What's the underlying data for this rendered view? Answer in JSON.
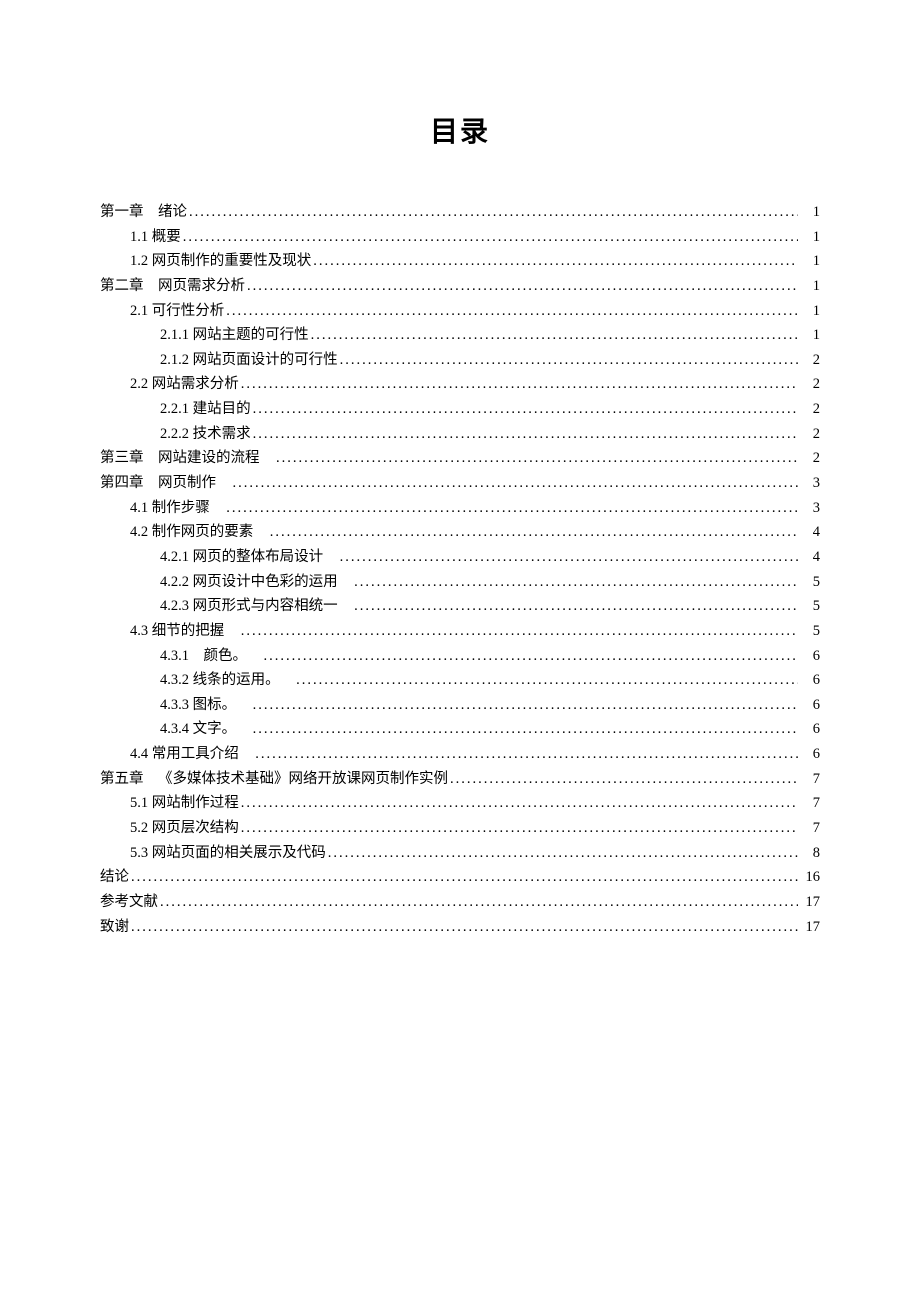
{
  "title": "目录",
  "toc": [
    {
      "level": 0,
      "label": "第一章 绪论 ",
      "page": "1"
    },
    {
      "level": 1,
      "label": "1.1 概要 ",
      "page": "1"
    },
    {
      "level": 1,
      "label": "1.2 网页制作的重要性及现状 ",
      "page": "1"
    },
    {
      "level": 0,
      "label": "第二章 网页需求分析 ",
      "page": "1"
    },
    {
      "level": 1,
      "label": "2.1 可行性分析 ",
      "page": "1"
    },
    {
      "level": 2,
      "label": "2.1.1 网站主题的可行性 ",
      "page": "1"
    },
    {
      "level": 2,
      "label": "2.1.2 网站页面设计的可行性 ",
      "page": "2"
    },
    {
      "level": 1,
      "label": "2.2 网站需求分析 ",
      "page": "2"
    },
    {
      "level": 2,
      "label": "2.2.1 建站目的 ",
      "page": "2"
    },
    {
      "level": 2,
      "label": "2.2.2 技术需求 ",
      "page": "2"
    },
    {
      "level": 0,
      "label": "第三章 网站建设的流程 ",
      "page": "2"
    },
    {
      "level": 0,
      "label": "第四章 网页制作 ",
      "page": "3"
    },
    {
      "level": 1,
      "label": "4.1 制作步骤 ",
      "page": "3"
    },
    {
      "level": 1,
      "label": "4.2 制作网页的要素 ",
      "page": "4"
    },
    {
      "level": 2,
      "label": "4.2.1 网页的整体布局设计  ",
      "page": "4"
    },
    {
      "level": 2,
      "label": "4.2.2 网页设计中色彩的运用  ",
      "page": "5"
    },
    {
      "level": 2,
      "label": "4.2.3 网页形式与内容相统一 ",
      "page": "5"
    },
    {
      "level": 1,
      "label": "4.3 细节的把握 ",
      "page": "5"
    },
    {
      "level": 2,
      "label": "4.3.1 颜色。 ",
      "page": "6"
    },
    {
      "level": 2,
      "label": "4.3.2 线条的运用。 ",
      "page": "6"
    },
    {
      "level": 2,
      "label": "4.3.3 图标。 ",
      "page": "6"
    },
    {
      "level": 2,
      "label": "4.3.4 文字。 ",
      "page": "6"
    },
    {
      "level": 1,
      "label": "4.4 常用工具介绍 ",
      "page": "6"
    },
    {
      "level": 0,
      "label": "第五章 《多媒体技术基础》网络开放课网页制作实例 ",
      "page": "7"
    },
    {
      "level": 1,
      "label": "5.1 网站制作过程 ",
      "page": "7"
    },
    {
      "level": 1,
      "label": "5.2 网页层次结构 ",
      "page": "7"
    },
    {
      "level": 1,
      "label": "5.3 网站页面的相关展示及代码 ",
      "page": "8"
    },
    {
      "level": 0,
      "label": "结论 ",
      "page": "16"
    },
    {
      "level": 0,
      "label": "参考文献 ",
      "page": "17"
    },
    {
      "level": 0,
      "label": "致谢 ",
      "page": "17"
    }
  ]
}
